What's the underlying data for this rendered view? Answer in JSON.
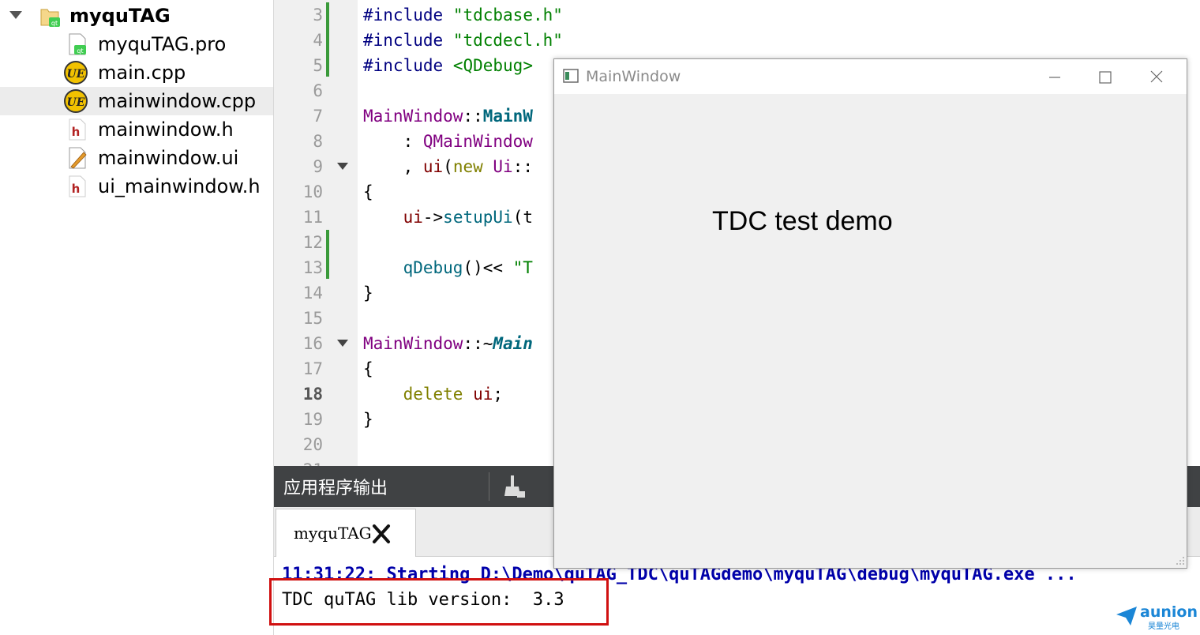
{
  "project_tree": {
    "root": {
      "label": "myquTAG",
      "icon": "qt-project-folder-icon"
    },
    "files": [
      {
        "label": "myquTAG.pro",
        "icon": "qt-pro-file-icon"
      },
      {
        "label": "main.cpp",
        "icon": "ue-cpp-file-icon"
      },
      {
        "label": "mainwindow.cpp",
        "icon": "ue-cpp-file-icon",
        "selected": true
      },
      {
        "label": "mainwindow.h",
        "icon": "header-file-icon"
      },
      {
        "label": "mainwindow.ui",
        "icon": "ui-form-file-icon"
      },
      {
        "label": "ui_mainwindow.h",
        "icon": "header-file-icon"
      }
    ]
  },
  "editor": {
    "line_numbers": [
      "3",
      "4",
      "5",
      "6",
      "7",
      "8",
      "9",
      "10",
      "11",
      "12",
      "13",
      "14",
      "15",
      "16",
      "17",
      "18",
      "19",
      "20"
    ],
    "current_line": "18",
    "lines": {
      "l3": {
        "directive": "#include",
        "arg": "\"tdcbase.h\""
      },
      "l4": {
        "directive": "#include",
        "arg": "\"tdcdecl.h\""
      },
      "l5": {
        "directive": "#include",
        "arg": "<QDebug>"
      },
      "l7": {
        "cls": "MainWindow",
        "sep": "::",
        "fn": "MainW"
      },
      "l8": {
        "prefix": "    : ",
        "cls": "QMainWindow"
      },
      "l9": {
        "prefix": "    , ",
        "var": "ui",
        "paren": "(",
        "kw": "new",
        "space": " ",
        "cls": "Ui",
        "sep": "::"
      },
      "l10": {
        "text": "{"
      },
      "l11": {
        "prefix": "    ",
        "var": "ui",
        "arrow": "->",
        "fn": "setupUi",
        "rest": "(t"
      },
      "l13": {
        "prefix": "    ",
        "fn": "qDebug",
        "op": "()<< ",
        "str": "\"T"
      },
      "l14": {
        "text": "}"
      },
      "l16": {
        "cls": "MainWindow",
        "sep": "::~",
        "fn": "Main"
      },
      "l17": {
        "text": "{"
      },
      "l18": {
        "prefix": "    ",
        "kw": "delete",
        "space": " ",
        "var": "ui",
        "end": ";"
      },
      "l19": {
        "text": "}"
      }
    }
  },
  "output_pane": {
    "title": "应用程序输出",
    "clean_icon": "clean-output-broom-icon",
    "tab": {
      "label": "myquTAG",
      "close_icon": "close-x-icon"
    },
    "lines": [
      "11:31:22: Starting D:\\Demo\\quTAG_TDC\\quTAGdemo\\myquTAG\\debug\\myquTAG.exe ...",
      "TDC quTAG lib version:  3.3"
    ],
    "highlight_color": "#d01010"
  },
  "main_window": {
    "title": "MainWindow",
    "label": "TDC test demo",
    "controls": [
      "minimize-icon",
      "maximize-icon",
      "close-icon"
    ]
  },
  "watermark": {
    "brand": "aunion",
    "sub": "昊量光电",
    "color": "#1b86d6"
  },
  "colors": {
    "preprocessor": "#000080",
    "string": "#008000",
    "class": "#800080",
    "function": "#00677c",
    "keyword": "#808000",
    "member": "#800000",
    "changebar": "#3a9a3a"
  }
}
